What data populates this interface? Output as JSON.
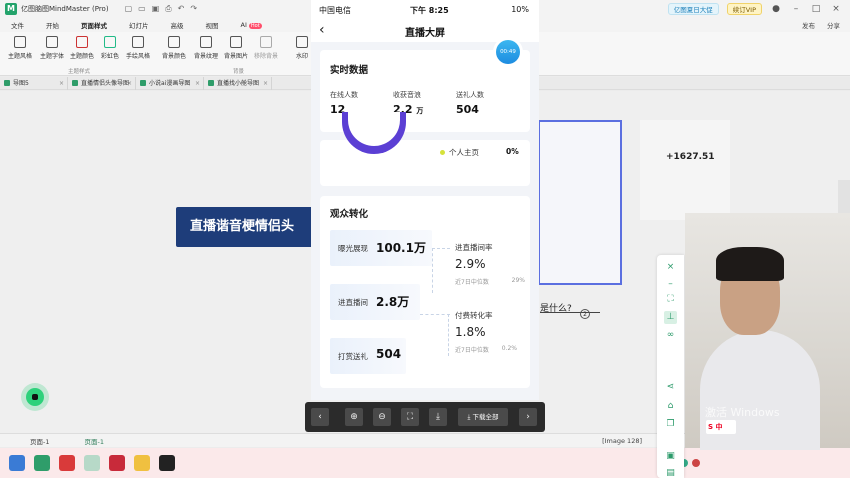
{
  "app": {
    "title": "亿图脑图MindMaster (Pro)",
    "summer_label": "亿图夏日大促",
    "vip_label": "续订VIP"
  },
  "menu": {
    "items": [
      "文件",
      "开始",
      "页面样式",
      "幻灯片",
      "高级",
      "视图",
      "AI"
    ],
    "ai_badge": "Hot",
    "right": [
      "发布",
      "分享"
    ]
  },
  "toolbar": {
    "tools": [
      "主题风格",
      "主题字体",
      "主题颜色",
      "彩虹色",
      "手绘风格",
      "背景颜色",
      "背景纹理",
      "背景图片",
      "移除背景",
      "水印"
    ],
    "group_theme": "主题样式",
    "group_bg": "背景"
  },
  "doc_tabs": [
    "导图5",
    "直播情侣头像导图",
    "小说ai漫画导图",
    "直播找小舱导图"
  ],
  "mindmap": {
    "central_topic": "直播谐音梗情侣头",
    "subtopic": "是什么?",
    "subtopic_number": "2"
  },
  "mini_right": {
    "value": "+1627.51"
  },
  "status": {
    "page_select": "页面-1",
    "page_tab": "页面-1",
    "image_label": "[Image 128]"
  },
  "phone": {
    "carrier": "中国电信",
    "time": "下午 8:25",
    "battery": "10%",
    "title": "直播大屏",
    "timer": "00:49",
    "realtime": {
      "heading": "实时数据",
      "stats": [
        {
          "label": "在线人数",
          "value": "12",
          "unit": ""
        },
        {
          "label": "收获音浪",
          "value": "2.2",
          "unit": "万"
        },
        {
          "label": "送礼人数",
          "value": "504",
          "unit": ""
        }
      ]
    },
    "pie_legend": {
      "label": "个人主页",
      "value": "0%"
    },
    "conversion": {
      "heading": "观众转化",
      "funnel": [
        {
          "label": "曝光展现",
          "value": "100.1万"
        },
        {
          "label": "进直播间",
          "value": "2.8万"
        },
        {
          "label": "打赏送礼",
          "value": "504"
        }
      ],
      "rates": [
        {
          "label": "进直播间率",
          "value": "2.9%",
          "median_label": "近7日中位数",
          "median": "29%"
        },
        {
          "label": "付费转化率",
          "value": "1.8%",
          "median_label": "近7日中位数",
          "median": "0.2%"
        }
      ]
    }
  },
  "viewer": {
    "download_all": "下载全部"
  },
  "video": {
    "watermark": "激活 Windows",
    "ime": "中"
  },
  "colors": {
    "accent_green": "#2f7d5a",
    "topic_blue": "#1e3d7a",
    "pie_purple": "#5b3fd4",
    "timer_blue": "#1d8ce0"
  }
}
